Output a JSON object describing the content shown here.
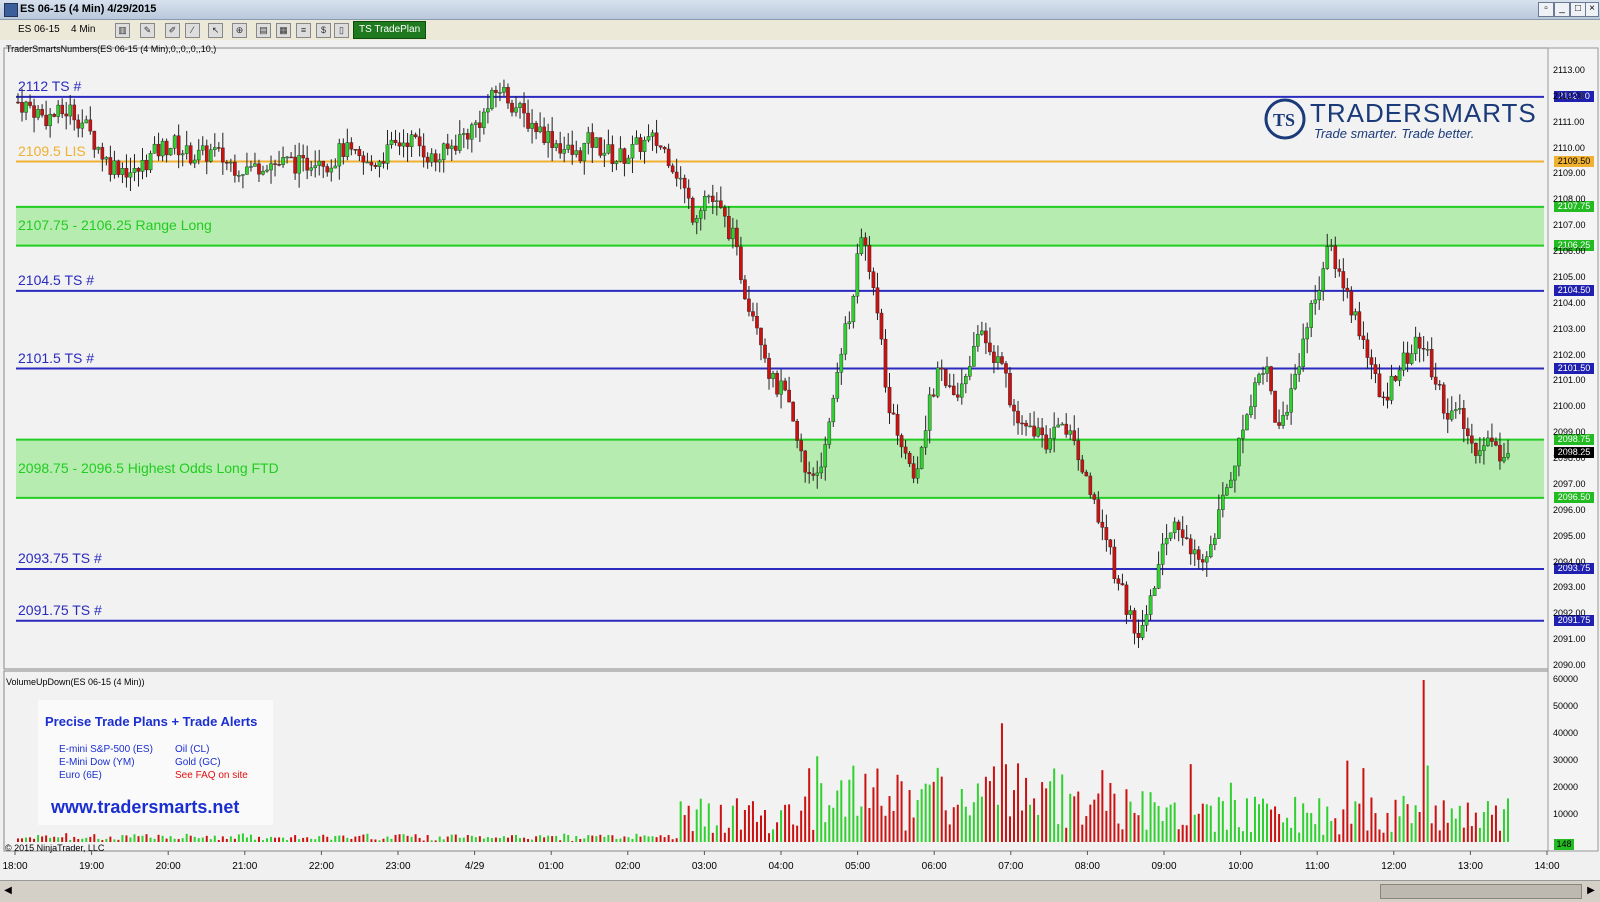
{
  "window": {
    "title": "ES 06-15 (4 Min)  4/29/2015"
  },
  "toolbar": {
    "instrument": "ES 06-15",
    "interval": "4 Min",
    "tradeplan_button": "TS TradePlan"
  },
  "indicator_top": "TraderSmartsNumbers(ES 06-15 (4 Min),0,,0,,0,,10,)",
  "indicator_bottom": "VolumeUpDown(ES 06-15 (4 Min))",
  "copyright": "© 2015 NinjaTrader, LLC",
  "logo": {
    "name": "TRADERSMARTS",
    "tagline": "Trade smarter. Trade better."
  },
  "levels": [
    {
      "label": "2112 TS #",
      "value": 2112.0,
      "price_tag": "2112.00",
      "color": "#2b2bbf"
    },
    {
      "label": "2109.5 LIS",
      "value": 2109.5,
      "price_tag": "2109.50",
      "color": "#f0b030"
    },
    {
      "label": "2104.5 TS #",
      "value": 2104.5,
      "price_tag": "2104.50",
      "color": "#2b2bbf"
    },
    {
      "label": "2101.5 TS #",
      "value": 2101.5,
      "price_tag": "2101.50",
      "color": "#2b2bbf"
    },
    {
      "label": "2093.75 TS #",
      "value": 2093.75,
      "price_tag": "2093.75",
      "color": "#2b2bbf"
    },
    {
      "label": "2091.75 TS #",
      "value": 2091.75,
      "price_tag": "2091.75",
      "color": "#2b2bbf"
    }
  ],
  "zones": [
    {
      "label": "2107.75 - 2106.25 Range Long",
      "high": 2107.75,
      "low": 2106.25,
      "high_tag": "2107.75",
      "low_tag": "2106.25"
    },
    {
      "label": "2098.75 - 2096.5 Highest Odds Long FTD",
      "high": 2098.75,
      "low": 2096.5,
      "high_tag": "2098.75",
      "low_tag": "2096.50"
    }
  ],
  "last_price_tag": "2098.25",
  "last_price": 2098.25,
  "volume_tag": "148",
  "price_axis": [
    "2113.00",
    "2112.00",
    "2111.00",
    "2110.00",
    "2109.00",
    "2108.00",
    "2107.00",
    "2106.00",
    "2105.00",
    "2104.00",
    "2103.00",
    "2102.00",
    "2101.00",
    "2100.00",
    "2099.00",
    "2098.00",
    "2097.00",
    "2096.00",
    "2095.00",
    "2094.00",
    "2093.00",
    "2092.00",
    "2091.00",
    "2090.00"
  ],
  "volume_axis": [
    "60000",
    "50000",
    "40000",
    "30000",
    "20000",
    "10000"
  ],
  "time_axis": [
    "18:00",
    "19:00",
    "20:00",
    "21:00",
    "22:00",
    "23:00",
    "4/29",
    "01:00",
    "02:00",
    "03:00",
    "04:00",
    "05:00",
    "06:00",
    "07:00",
    "08:00",
    "09:00",
    "10:00",
    "11:00",
    "12:00",
    "13:00",
    "14:00"
  ],
  "promo": {
    "title": "Precise Trade Plans + Trade Alerts",
    "items_left": [
      "E-mini S&P-500 (ES)",
      "E-Mini Dow (YM)",
      "Euro (6E)"
    ],
    "items_right": [
      "Oil (CL)",
      "Gold (GC)",
      "See FAQ on site"
    ],
    "url": "www.tradersmarts.net"
  },
  "colors": {
    "up": "#2fd02f",
    "down": "#cc1111",
    "blue_line": "#2b2bbf",
    "lis_line": "#f0b030",
    "zone_fill": "#b6ecb0",
    "zone_line": "#22cc22"
  },
  "price_path": [
    [
      0,
      2111.8
    ],
    [
      5,
      2111.6
    ],
    [
      10,
      2111.2
    ],
    [
      15,
      2111.3
    ],
    [
      20,
      2111.5
    ],
    [
      25,
      2111.0
    ],
    [
      30,
      2110.2
    ],
    [
      35,
      2109.4
    ],
    [
      40,
      2109.3
    ],
    [
      45,
      2109.0
    ],
    [
      50,
      2109.6
    ],
    [
      55,
      2110.0
    ],
    [
      60,
      2110.2
    ],
    [
      65,
      2109.8
    ],
    [
      70,
      2109.7
    ],
    [
      75,
      2109.9
    ],
    [
      80,
      2109.5
    ],
    [
      85,
      2109.3
    ],
    [
      90,
      2109.2
    ],
    [
      95,
      2109.5
    ],
    [
      100,
      2109.4
    ],
    [
      105,
      2109.5
    ],
    [
      110,
      2109.3
    ],
    [
      115,
      2109.8
    ],
    [
      120,
      2109.4
    ],
    [
      125,
      2110.0
    ],
    [
      130,
      2109.6
    ],
    [
      135,
      2109.3
    ],
    [
      140,
      2109.7
    ],
    [
      145,
      2110.1
    ],
    [
      150,
      2110.4
    ],
    [
      155,
      2110.1
    ],
    [
      160,
      2109.5
    ],
    [
      165,
      2109.9
    ],
    [
      170,
      2110.4
    ],
    [
      175,
      2110.8
    ],
    [
      180,
      2111.4
    ],
    [
      185,
      2112.4
    ],
    [
      190,
      2111.8
    ],
    [
      195,
      2111.2
    ],
    [
      200,
      2110.8
    ],
    [
      205,
      2110.4
    ],
    [
      210,
      2110.0
    ],
    [
      215,
      2109.7
    ],
    [
      220,
      2110.3
    ],
    [
      225,
      2110.0
    ],
    [
      230,
      2109.6
    ],
    [
      235,
      2109.8
    ],
    [
      240,
      2110.2
    ],
    [
      245,
      2110.3
    ],
    [
      250,
      2109.8
    ],
    [
      255,
      2108.8
    ],
    [
      260,
      2107.4
    ],
    [
      265,
      2108.3
    ],
    [
      270,
      2107.6
    ],
    [
      275,
      2106.6
    ],
    [
      280,
      2104.4
    ],
    [
      285,
      2103.2
    ],
    [
      290,
      2101.0
    ],
    [
      295,
      2100.5
    ],
    [
      300,
      2098.6
    ],
    [
      305,
      2097.0
    ],
    [
      310,
      2098.0
    ],
    [
      315,
      2101.2
    ],
    [
      320,
      2103.6
    ],
    [
      325,
      2106.8
    ],
    [
      330,
      2104.2
    ],
    [
      335,
      2100.2
    ],
    [
      340,
      2098.8
    ],
    [
      345,
      2097.2
    ],
    [
      350,
      2099.8
    ],
    [
      355,
      2101.6
    ],
    [
      360,
      2100.2
    ],
    [
      365,
      2101.0
    ],
    [
      370,
      2103.2
    ],
    [
      375,
      2102.0
    ],
    [
      380,
      2101.2
    ],
    [
      385,
      2099.0
    ],
    [
      390,
      2099.2
    ],
    [
      395,
      2098.6
    ],
    [
      400,
      2099.6
    ],
    [
      405,
      2099.0
    ],
    [
      410,
      2097.6
    ],
    [
      415,
      2095.8
    ],
    [
      420,
      2094.4
    ],
    [
      425,
      2092.8
    ],
    [
      430,
      2091.2
    ],
    [
      435,
      2092.2
    ],
    [
      440,
      2094.2
    ],
    [
      445,
      2095.4
    ],
    [
      450,
      2095.0
    ],
    [
      455,
      2093.6
    ],
    [
      460,
      2095.0
    ],
    [
      465,
      2096.8
    ],
    [
      470,
      2098.6
    ],
    [
      475,
      2100.6
    ],
    [
      480,
      2101.8
    ],
    [
      485,
      2099.0
    ],
    [
      490,
      2100.6
    ],
    [
      495,
      2102.8
    ],
    [
      500,
      2104.6
    ],
    [
      505,
      2106.2
    ],
    [
      510,
      2104.8
    ],
    [
      515,
      2103.4
    ],
    [
      520,
      2102.0
    ],
    [
      525,
      2100.0
    ],
    [
      530,
      2101.4
    ],
    [
      535,
      2102.0
    ],
    [
      540,
      2102.6
    ],
    [
      545,
      2101.2
    ],
    [
      550,
      2099.8
    ],
    [
      555,
      2099.6
    ],
    [
      560,
      2098.4
    ],
    [
      565,
      2098.8
    ],
    [
      570,
      2098.2
    ],
    [
      575,
      2098.6
    ]
  ]
}
